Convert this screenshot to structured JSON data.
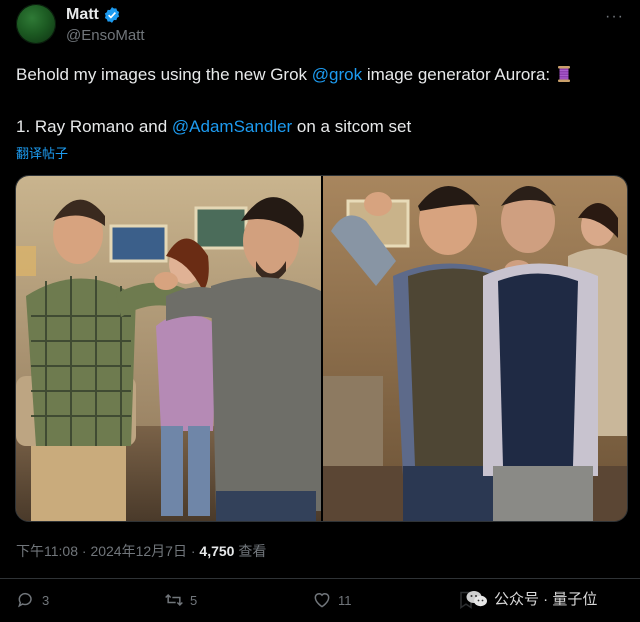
{
  "author": {
    "name": "Matt",
    "handle": "@EnsoMatt",
    "verified": true,
    "avatar_color": "#2f7a36"
  },
  "tweet": {
    "line1_prefix": "Behold my images using the new Grok ",
    "line1_mention": "@grok",
    "line1_suffix": " image generator Aurora: ",
    "line1_emoji": "thread-spool-icon",
    "line2_prefix": "1. Ray Romano and ",
    "line2_mention": "@AdamSandler",
    "line2_suffix": " on a sitcom set",
    "translate_label": "翻译帖子"
  },
  "meta": {
    "time": "下午11:08",
    "sep1": " · ",
    "date": "2024年12月7日",
    "sep2": " · ",
    "views_count": "4,750",
    "views_label": " 查看"
  },
  "actions": {
    "replies": "3",
    "reposts": "5",
    "likes": "11"
  },
  "watermark": {
    "text": "公众号 · 量子位"
  },
  "colors": {
    "background": "#000000",
    "accent": "#1d9bf0",
    "muted": "#71767b",
    "text": "#e7e9ea"
  }
}
